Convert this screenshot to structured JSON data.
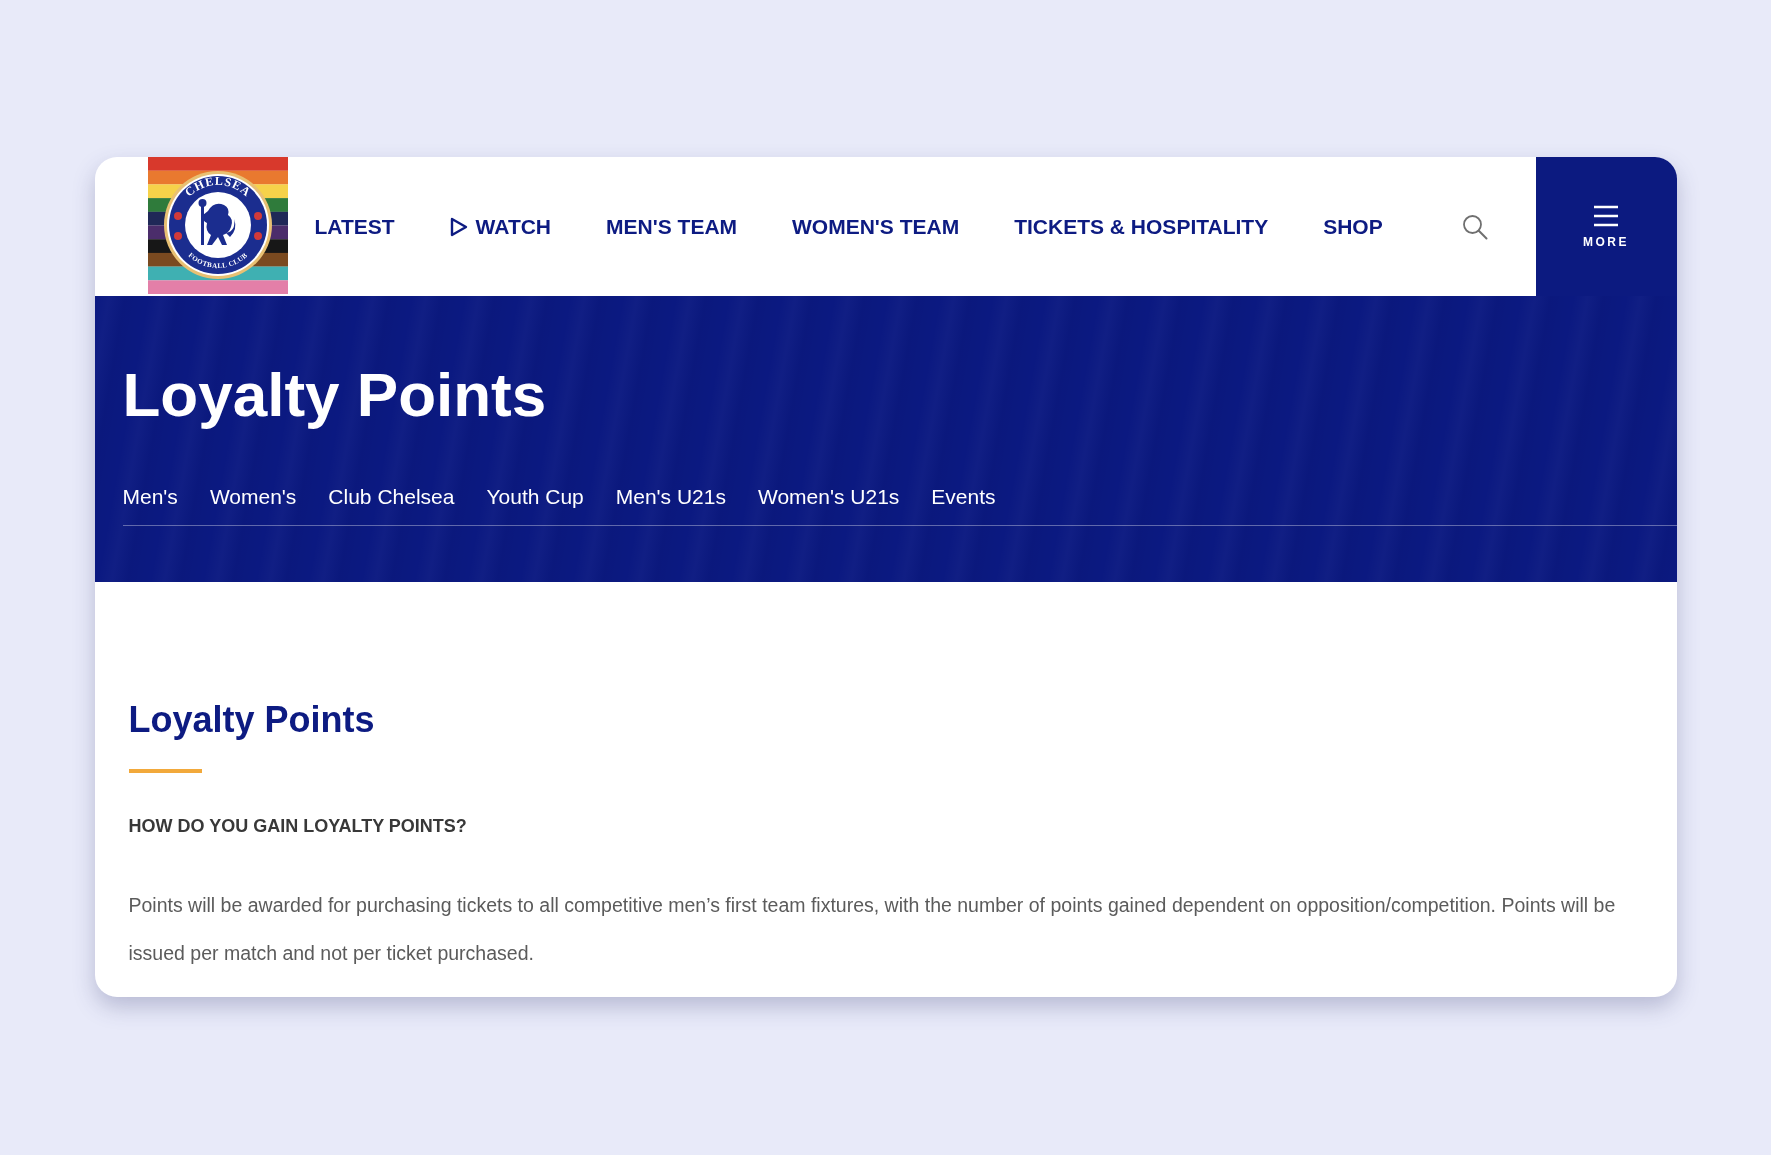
{
  "header": {
    "logo": {
      "crest_top": "CHELSEA",
      "crest_bottom": "FOOTBALL CLUB"
    },
    "nav": [
      {
        "label": "LATEST",
        "kind": "link"
      },
      {
        "label": "WATCH",
        "kind": "video"
      },
      {
        "label": "MEN'S TEAM",
        "kind": "link"
      },
      {
        "label": "WOMEN'S TEAM",
        "kind": "link"
      },
      {
        "label": "TICKETS & HOSPITALITY",
        "kind": "link"
      },
      {
        "label": "SHOP",
        "kind": "link"
      }
    ],
    "more_button": {
      "label": "MORE"
    }
  },
  "hero": {
    "title": "Loyalty Points",
    "tabs": [
      {
        "label": "Men's",
        "selected": false
      },
      {
        "label": "Women's",
        "selected": false
      },
      {
        "label": "Club Chelsea",
        "selected": false
      },
      {
        "label": "Youth Cup",
        "selected": false
      },
      {
        "label": "Men's U21s",
        "selected": false
      },
      {
        "label": "Women's U21s",
        "selected": false
      },
      {
        "label": "Events",
        "selected": false
      }
    ]
  },
  "content": {
    "title": "Loyalty Points",
    "subheading": "HOW DO YOU GAIN LOYALTY POINTS?",
    "paragraph": "Points will be awarded for purchasing tickets to all competitive men’s first team fixtures, with the number of points gained dependent on opposition/competition. Points will be issued per match and not per ticket purchased."
  }
}
